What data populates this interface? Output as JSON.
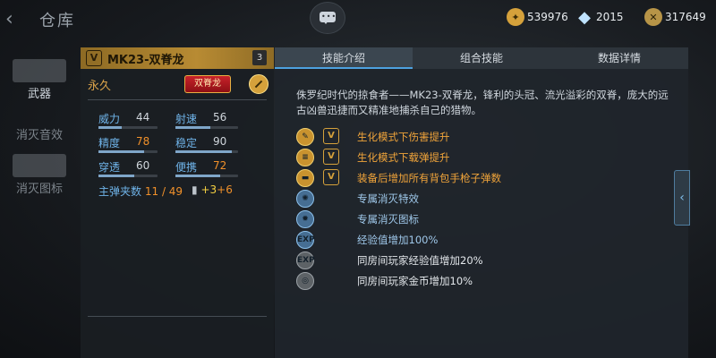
{
  "header": {
    "back_glyph": "‹",
    "title": "仓库"
  },
  "currency": [
    {
      "icon": "gold-coin-icon",
      "value": "539976"
    },
    {
      "icon": "diamond-icon",
      "value": "2015"
    },
    {
      "icon": "honor-coin-icon",
      "value": "317649"
    }
  ],
  "sidenav": [
    {
      "label": "武器",
      "active": true
    },
    {
      "label": "消灭音效",
      "active": false
    },
    {
      "label": "消灭图标",
      "active": false
    }
  ],
  "weapon": {
    "vip_glyph": "V",
    "name": "MK23-双脊龙",
    "count": "3",
    "duration": "永久",
    "tag": "双脊龙",
    "stats": [
      {
        "label": "威力",
        "value": "44",
        "boosted": false,
        "level": 0.4
      },
      {
        "label": "射速",
        "value": "56",
        "boosted": false,
        "level": 0.55
      },
      {
        "label": "精度",
        "value": "78",
        "boosted": true,
        "level": 0.78
      },
      {
        "label": "稳定",
        "value": "90",
        "boosted": false,
        "level": 0.9
      },
      {
        "label": "穿透",
        "value": "60",
        "boosted": false,
        "level": 0.6
      },
      {
        "label": "便携",
        "value": "72",
        "boosted": true,
        "level": 0.72
      }
    ],
    "ammo_label": "主弹夹数",
    "ammo_value": "11",
    "ammo_total": "49",
    "bullet_glyph": "▮",
    "bullet_bonus_a": "+3",
    "bullet_bonus_b": "+6"
  },
  "tabs": [
    {
      "label": "技能介绍",
      "active": true
    },
    {
      "label": "组合技能",
      "active": false
    },
    {
      "label": "数据详情",
      "active": false
    }
  ],
  "description": "侏罗纪时代的掠食者——MK23-双脊龙，锋利的头冠、流光溢彩的双脊，庞大的远古凶兽迅捷而又精准地捕杀自己的猎物。",
  "skills": [
    {
      "icon": "zombie-damage-icon",
      "style": "gold",
      "vip": true,
      "text": "生化模式下伤害提升"
    },
    {
      "icon": "zombie-ammo-icon",
      "style": "gold",
      "vip": true,
      "text": "生化模式下载弹提升"
    },
    {
      "icon": "pistol-ammo-icon",
      "style": "gold",
      "vip": true,
      "text": "装备后增加所有背包手枪子弹数"
    },
    {
      "icon": "kill-effect-icon",
      "style": "blue",
      "vip": false,
      "text": "专属消灭特效"
    },
    {
      "icon": "kill-badge-icon",
      "style": "blue",
      "vip": false,
      "text": "专属消灭图标"
    },
    {
      "icon": "exp-icon",
      "style": "blue",
      "vip": false,
      "text": "经验值增加100%"
    },
    {
      "icon": "room-exp-icon",
      "style": "grey",
      "vip": false,
      "text": "同房间玩家经验值增加20%"
    },
    {
      "icon": "room-gold-icon",
      "style": "grey",
      "vip": false,
      "text": "同房间玩家金币增加10%"
    }
  ],
  "skill_glyphs": [
    "✎",
    "≡",
    "▬",
    "✺",
    "✹",
    "EXP",
    "EXP",
    "◎"
  ],
  "expand_glyph": "‹"
}
